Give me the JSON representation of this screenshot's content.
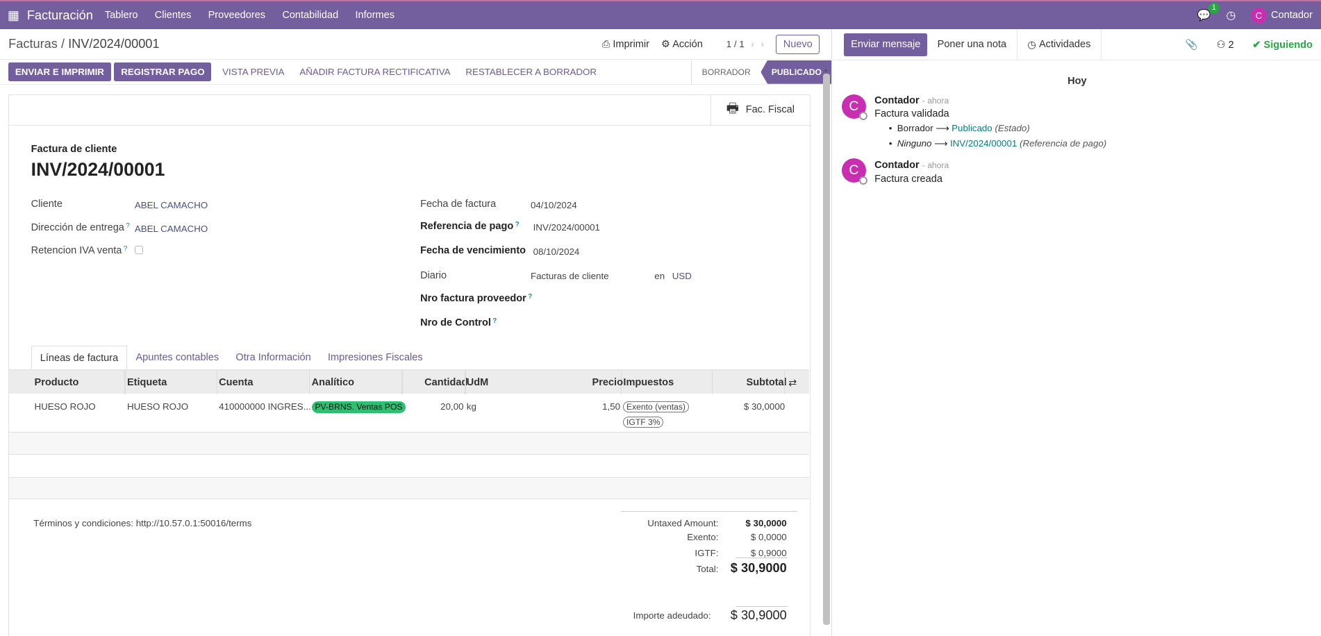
{
  "navbar": {
    "app_name": "Facturación",
    "menus": [
      "Tablero",
      "Clientes",
      "Proveedores",
      "Contabilidad",
      "Informes"
    ],
    "chat_count": "1",
    "user_initial": "C",
    "user_name": "Contador"
  },
  "control_panel": {
    "breadcrumb_parent": "Facturas",
    "breadcrumb_sep": "/",
    "breadcrumb_current": "INV/2024/00001",
    "print_label": "Imprimir",
    "action_label": "Acción",
    "pager": "1 / 1",
    "new_label": "Nuevo"
  },
  "statusbar": {
    "buttons_primary": [
      "ENVIAR E IMPRIMIR",
      "REGISTRAR PAGO"
    ],
    "buttons_link": [
      "VISTA PREVIA",
      "AÑADIR FACTURA RECTIFICATIVA",
      "RESTABLECER A BORRADOR"
    ],
    "states": [
      "BORRADOR",
      "PUBLICADO"
    ],
    "current_state": "PUBLICADO"
  },
  "sheet": {
    "fiscal_button": "Fac. Fiscal",
    "doc_type": "Factura de cliente",
    "number": "INV/2024/00001",
    "left_fields": {
      "cliente_label": "Cliente",
      "cliente_value": "ABEL CAMACHO",
      "direccion_label": "Dirección de entrega",
      "direccion_value": "ABEL CAMACHO",
      "retencion_label": "Retencion IVA venta"
    },
    "right_fields": {
      "fecha_label": "Fecha de factura",
      "fecha_value": "04/10/2024",
      "referencia_label": "Referencia de pago",
      "referencia_value": "INV/2024/00001",
      "vencimiento_label": "Fecha de vencimiento",
      "vencimiento_value": "08/10/2024",
      "diario_label": "Diario",
      "diario_value": "Facturas de cliente",
      "diario_en": "en",
      "currency": "USD",
      "nro_proveedor_label": "Nro factura proveedor",
      "nro_control_label": "Nro de Control"
    },
    "help_mark": "?",
    "tabs": [
      "Líneas de factura",
      "Apuntes contables",
      "Otra Información",
      "Impresiones Fiscales"
    ],
    "columns": [
      "Producto",
      "Etiqueta",
      "Cuenta",
      "Analítico",
      "Cantidad",
      "UdM",
      "Precio",
      "Impuestos",
      "Subtotal"
    ],
    "line": {
      "producto": "HUESO ROJO",
      "etiqueta": "HUESO ROJO",
      "cuenta": "410000000 INGRES...",
      "analitico": "PV-BRNS. Ventas POS",
      "cantidad": "20,00",
      "udm": "kg",
      "precio": "1,50",
      "impuesto_1": "Exento (ventas)",
      "impuesto_2": "IGTF 3%",
      "subtotal": "$ 30,0000"
    },
    "terms": "Términos y condiciones: http://10.57.0.1:50016/terms",
    "totals": {
      "untaxed_label": "Untaxed Amount:",
      "untaxed_value": "$ 30,0000",
      "exento_label": "Exento:",
      "exento_value": "$ 0,0000",
      "igtf_label": "IGTF:",
      "igtf_value": "$ 0,9000",
      "total_label": "Total:",
      "total_value": "$ 30,9000",
      "due_label": "Importe adeudado:",
      "due_value": "$ 30,9000"
    }
  },
  "chatter": {
    "send_message": "Enviar mensaje",
    "log_note": "Poner una nota",
    "activities": "Actividades",
    "followers_count": "2",
    "following": "Siguiendo",
    "day_label": "Hoy",
    "messages": [
      {
        "initial": "C",
        "author": "Contador",
        "time": "- ahora",
        "body": "Factura validada",
        "changes": [
          {
            "old": "Borrador",
            "new": "Publicado",
            "field": "(Estado)"
          },
          {
            "old": "Ninguno",
            "new": "INV/2024/00001",
            "field": "(Referencia de pago)"
          }
        ]
      },
      {
        "initial": "C",
        "author": "Contador",
        "time": "- ahora",
        "body": "Factura creada"
      }
    ]
  },
  "colors": {
    "brand": "#735f9e",
    "success": "#28a745",
    "tag": "#2fbf71",
    "avatar": "#c72fb0"
  }
}
